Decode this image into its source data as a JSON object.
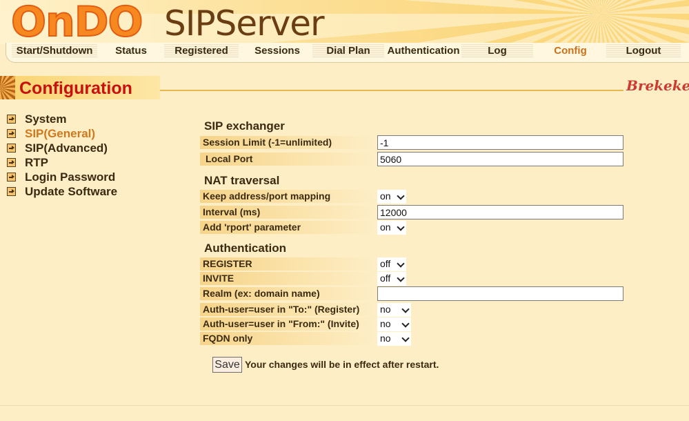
{
  "header": {
    "logo_ondo": "OnDO",
    "logo_sip": "SIPServer"
  },
  "nav": {
    "items": [
      {
        "label": "Start/Shutdown"
      },
      {
        "label": "Status"
      },
      {
        "label": "Registered"
      },
      {
        "label": "Sessions"
      },
      {
        "label": "Dial Plan"
      },
      {
        "label": "Authentication"
      },
      {
        "label": "Log"
      },
      {
        "label": "Config"
      },
      {
        "label": "Logout"
      }
    ],
    "active": "Config"
  },
  "page": {
    "title": "Configuration",
    "brand": "Brekeke"
  },
  "sidebar": {
    "items": [
      {
        "label": "System"
      },
      {
        "label": "SIP(General)"
      },
      {
        "label": "SIP(Advanced)"
      },
      {
        "label": "RTP"
      },
      {
        "label": "Login Password"
      },
      {
        "label": "Update Software"
      }
    ],
    "active": "SIP(General)"
  },
  "sections": {
    "sip_exchanger": {
      "heading": "SIP exchanger",
      "session_limit": {
        "label": "Session Limit (-1=unlimited)",
        "value": "-1"
      },
      "local_port": {
        "label": "Local Port",
        "value": "5060"
      }
    },
    "nat": {
      "heading": "NAT traversal",
      "keep_mapping": {
        "label": "Keep address/port mapping",
        "value": "on"
      },
      "interval": {
        "label": "Interval (ms)",
        "value": "12000"
      },
      "rport": {
        "label": "Add 'rport' parameter",
        "value": "on"
      }
    },
    "auth": {
      "heading": "Authentication",
      "register": {
        "label": "REGISTER",
        "value": "off"
      },
      "invite": {
        "label": "INVITE",
        "value": "off"
      },
      "realm": {
        "label": "Realm (ex: domain name)",
        "value": ""
      },
      "auth_to": {
        "label": "Auth-user=user in \"To:\" (Register)",
        "value": "no"
      },
      "auth_from": {
        "label": "Auth-user=user in \"From:\" (Invite)",
        "value": "no"
      },
      "fqdn": {
        "label": "FQDN only",
        "value": "no"
      }
    }
  },
  "save": {
    "label": "Save",
    "note": "Your changes will be in effect after restart."
  },
  "colors": {
    "title": "#c8100e",
    "active_link": "#d1771c",
    "background": "#fdeec6"
  }
}
